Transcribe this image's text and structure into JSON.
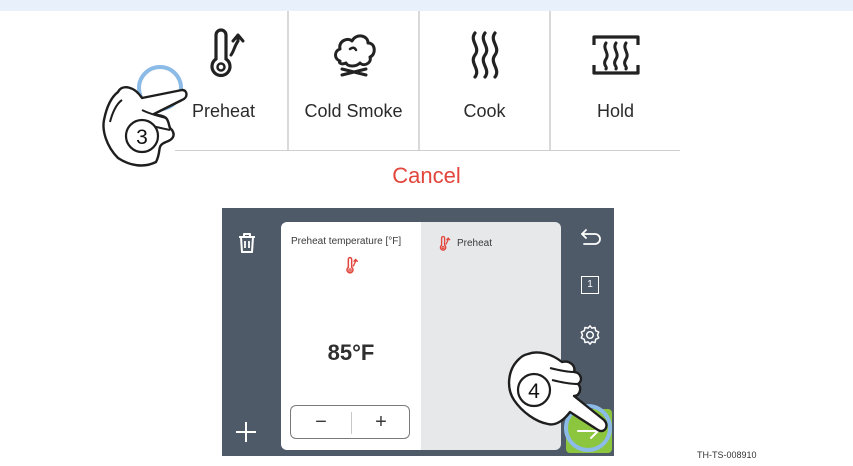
{
  "mode_menu": {
    "items": [
      {
        "label": "Preheat",
        "icon": "thermometer-up-icon"
      },
      {
        "label": "Cold Smoke",
        "icon": "smoke-cloud-icon"
      },
      {
        "label": "Cook",
        "icon": "heat-waves-icon"
      },
      {
        "label": "Hold",
        "icon": "hold-heat-icon"
      }
    ],
    "cancel_label": "Cancel"
  },
  "controller": {
    "card_title": "Preheat temperature [°F]",
    "temperature": "85°F",
    "stepper": {
      "minus": "−",
      "plus": "+"
    },
    "stage_label": "Preheat",
    "side_icons": [
      "delete-icon",
      "plus-icon",
      "back-icon",
      "program-1-icon",
      "settings-icon",
      "next-arrow-icon"
    ],
    "program_number": "1"
  },
  "callouts": [
    {
      "step": "3"
    },
    {
      "step": "4"
    }
  ],
  "figure_code": "TH-TS-008910",
  "colors": {
    "accent_red": "#e2453b",
    "screen_bg": "#4f5a68",
    "next_green": "#8cc63f",
    "touch_ring": "#8bbbe6"
  }
}
